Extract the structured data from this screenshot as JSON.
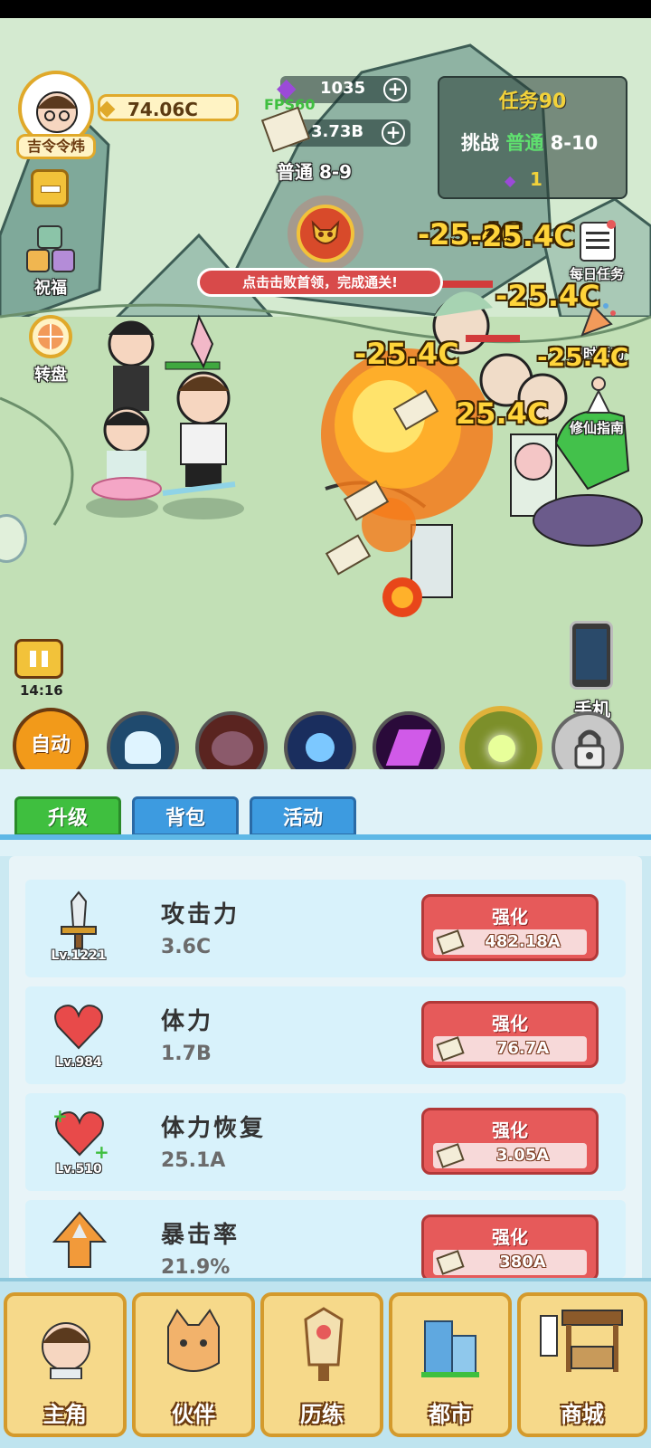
{
  "player": {
    "name": "吉令令炜",
    "gold": "74.06C"
  },
  "resources": {
    "gems": "1035",
    "fps": "FPS60",
    "cash": "3.73B",
    "stage": "普通 8-9"
  },
  "quest": {
    "title": "任务90",
    "challenge_prefix": "挑战",
    "challenge_mode": "普通",
    "challenge_stage": "8-10",
    "item_count": "1"
  },
  "boss_hint": "点击击败首领，完成通关!",
  "left_menu": {
    "bless": "祝福",
    "wheel": "转盘"
  },
  "right_menu": {
    "daily": "每日任务",
    "limited": "限时活动",
    "guide": "修仙指南",
    "phone": "手机"
  },
  "damage_numbers": [
    "-25.4C",
    "-25.4C",
    "-25.4C",
    "-25.4C",
    "25.4C",
    "-25.4C"
  ],
  "timer": "14:16",
  "auto_label": "自动",
  "tabs": [
    "升级",
    "背包",
    "活动"
  ],
  "upgrades": [
    {
      "name": "攻击力",
      "value": "3.6C",
      "level": "Lv.1221",
      "button": "强化",
      "cost": "482.18A"
    },
    {
      "name": "体力",
      "value": "1.7B",
      "level": "Lv.984",
      "button": "强化",
      "cost": "76.7A"
    },
    {
      "name": "体力恢复",
      "value": "25.1A",
      "level": "Lv.510",
      "button": "强化",
      "cost": "3.05A"
    },
    {
      "name": "暴击率",
      "value": "21.9%",
      "level": "",
      "button": "强化",
      "cost": "380A"
    }
  ],
  "bottom_nav": [
    "主角",
    "伙伴",
    "历练",
    "都市",
    "商城"
  ],
  "colors": {
    "accent_gold": "#e0a92a",
    "upgrade_red": "#e65a5a",
    "tab_active": "#3fbf3f",
    "tab_inactive": "#3d9be0"
  }
}
